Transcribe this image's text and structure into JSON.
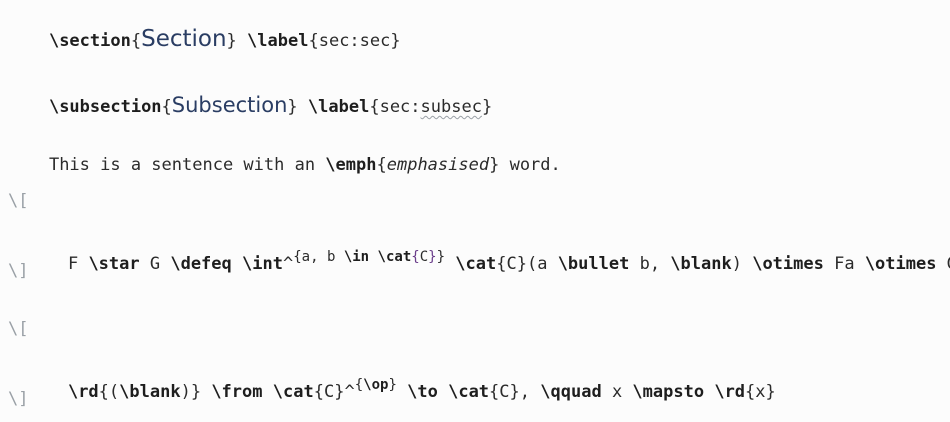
{
  "line1": {
    "cmd": "\\section",
    "open": "{",
    "heading": "Section",
    "close": "}",
    "label_cmd": "\\label",
    "label_open": "{",
    "label_value": "sec:sec",
    "label_close": "}"
  },
  "line2": {
    "cmd": "\\subsection",
    "open": "{",
    "heading": "Subsection",
    "close": "}",
    "label_cmd": "\\label",
    "label_open": "{",
    "label_value_prefix": "sec:",
    "label_value_misspelled": "subsec",
    "label_close": "}"
  },
  "line3": {
    "text_before": "This is a sentence with an ",
    "emph_cmd": "\\emph",
    "open": "{",
    "emph_text": "emphasised",
    "close": "}",
    "text_after": " word."
  },
  "math1": {
    "open_delim": "\\[",
    "part1": "F ",
    "star": "\\star",
    "part2": " G ",
    "defeq": "\\defeq",
    "space1": " ",
    "int": "\\int",
    "caret": "^",
    "sup_open": "{",
    "sup_a": "a, b ",
    "sup_in": "\\in",
    "sup_space": " ",
    "sup_cat": "\\cat",
    "sup_C_open": "{",
    "sup_C": "C",
    "sup_C_close": "}",
    "sup_close": "}",
    "space2": " ",
    "cat": "\\cat",
    "c_open": "{",
    "c_val": "C",
    "c_close": "}",
    "paren": "(a ",
    "bullet": "\\bullet",
    "mid": " b, ",
    "blank": "\\blank",
    "close_paren": ") ",
    "otimes1": "\\otimes",
    "fa": " Fa ",
    "otimes2": "\\otimes",
    "gb": " Gb",
    "close_delim": "\\]"
  },
  "math2": {
    "open_delim": "\\[",
    "rd": "\\rd",
    "brace_open": "{(",
    "blank": "\\blank",
    "brace_close": ")}",
    "space1": " ",
    "from": "\\from",
    "space2": " ",
    "cat1": "\\cat",
    "c1_open": "{",
    "c1": "C",
    "c1_close": "}",
    "caret": "^",
    "sup_open": "{",
    "op": "\\op",
    "sup_close": "}",
    "space3": " ",
    "to": "\\to",
    "space4": " ",
    "cat2": "\\cat",
    "c2_open": "{",
    "c2": "C",
    "c2_close": "},",
    "space5": " ",
    "qquad": "\\qquad",
    "x_part": " x ",
    "mapsto": "\\mapsto",
    "space6": " ",
    "rd2": "\\rd",
    "x_open": "{",
    "x_val": "x",
    "x_close": "}",
    "close_delim": "\\]"
  }
}
